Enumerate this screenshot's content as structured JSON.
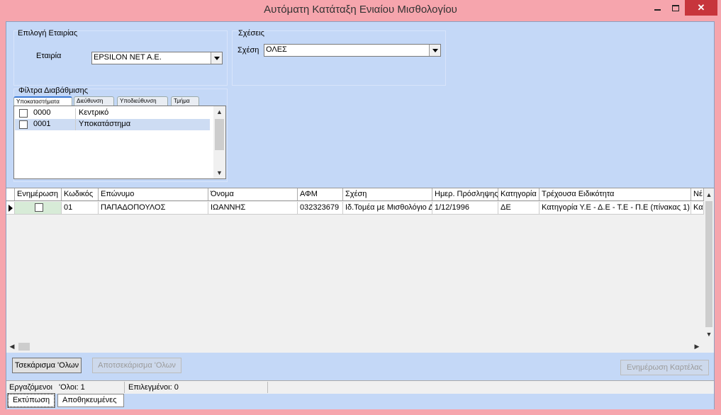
{
  "window": {
    "title": "Αυτόματη Κατάταξη Ενιαίου Μισθολογίου"
  },
  "company_group": {
    "title": "Επιλογή Εταιρίας",
    "label": "Εταιρία",
    "value": "EPSILON NET A.E."
  },
  "relations_group": {
    "title": "Σχέσεις",
    "label": "Σχέση",
    "value": "ΟΛΕΣ"
  },
  "filter_group": {
    "title": "Φίλτρα Διαβάθμισης",
    "tabs": [
      "Υποκαταστήματα",
      "Διεύθυνση",
      "Υποδιεύθυνση",
      "Τμήμα"
    ],
    "items": [
      {
        "code": "0000",
        "name": "Κεντρικό"
      },
      {
        "code": "0001",
        "name": "Υποκατάστημα"
      }
    ]
  },
  "grid": {
    "columns": [
      "Ενημέρωση",
      "Κωδικός",
      "Επώνυμο",
      "Όνομα",
      "ΑΦΜ",
      "Σχέση",
      "Ημερ. Πρόσληψης",
      "Κατηγορία",
      "Τρέχουσα Ειδικότητα",
      "Νέ"
    ],
    "rows": [
      {
        "code": "01",
        "surname": "ΠΑΠΑΔΟΠΟΥΛΟΣ",
        "name": "ΙΩΑΝΝΗΣ",
        "afm": "032323679",
        "relation": "Ιδ.Τομέα με Μισθολόγιο ΔΕ",
        "hire_date": "1/12/1996",
        "category": "ΔΕ",
        "specialty": "Κατηγορία Υ.Ε - Δ.Ε - Τ.Ε - Π.Ε (πίνακας 1)",
        "new": "Κα"
      }
    ]
  },
  "buttons": {
    "check_all": "Τσεκάρισμα 'Ολων",
    "uncheck_all": "Αποτσεκάρισμα 'Ολων",
    "update_cards": "Ενημέρωση Καρτέλας"
  },
  "status": {
    "label": "Εργαζόμενοι",
    "total": "'Ολοι: 1",
    "selected": "Επιλεγμένοι: 0"
  },
  "bottom_tabs": [
    "Εκτύπωση",
    "Αποθηκευμένες"
  ]
}
